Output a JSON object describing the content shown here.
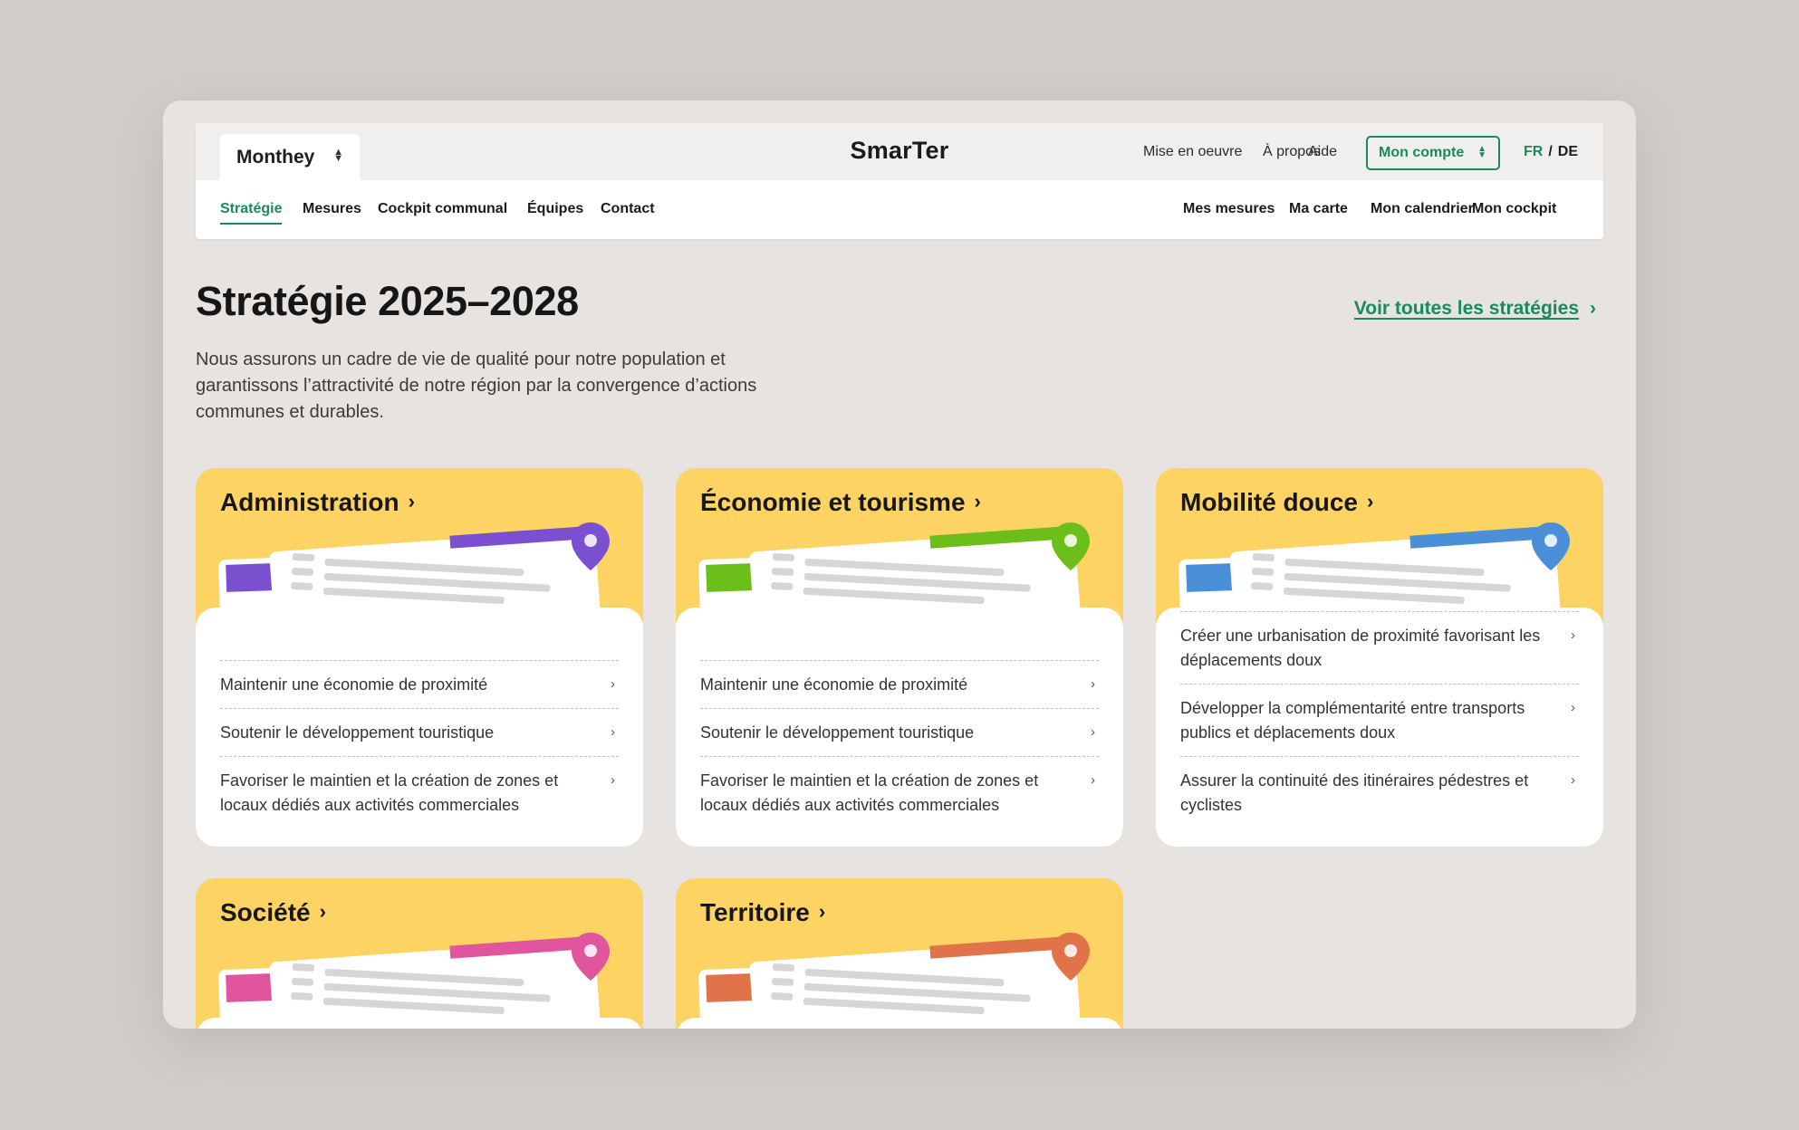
{
  "header": {
    "commune": "Monthey",
    "brand": "SmarTer",
    "utility": [
      "Mise en oeuvre",
      "À propos",
      "Aide"
    ],
    "account": "Mon compte",
    "lang_fr": "FR",
    "lang_sep": "/",
    "lang_de": "DE",
    "nav_left": [
      "Stratégie",
      "Mesures",
      "Cockpit communal",
      "Équipes",
      "Contact"
    ],
    "nav_right": [
      "Mes mesures",
      "Ma carte",
      "Mon calendrier",
      "Mon cockpit"
    ]
  },
  "page": {
    "title": "Stratégie 2025–2028",
    "all_link": "Voir toutes les stratégies",
    "lede": "Nous assurons un cadre de vie de qualité pour notre population et garantissons l’attractivité de notre région par la convergence d’actions communes et durables."
  },
  "cards": [
    {
      "title": "Administration",
      "accent": "#7a4fd0",
      "items": [
        "Maintenir une économie de proximité",
        "Soutenir le développement touristique",
        "Favoriser le maintien et la création de zones et locaux dédiés aux activités commerciales"
      ]
    },
    {
      "title": "Économie et tourisme",
      "accent": "#6cbf1a",
      "items": [
        "Maintenir une économie de proximité",
        "Soutenir le développement touristique",
        "Favoriser le maintien et la création de zones et locaux dédiés aux activités commerciales"
      ]
    },
    {
      "title": "Mobilité douce",
      "accent": "#4a8fd8",
      "items": [
        "Créer une urbanisation de proximité favorisant les déplacements doux",
        "Développer la complémentarité entre transports publics et déplacements doux",
        "Assurer la continuité des itinéraires pédestres et cyclistes"
      ]
    },
    {
      "title": "Société",
      "accent": "#e0559e",
      "items": []
    },
    {
      "title": "Territoire",
      "accent": "#e0734a",
      "items": []
    }
  ],
  "colors": {
    "brand_green": "#1a8a5e",
    "card_yellow": "#fdd363",
    "page_bg": "#e6e3e1"
  },
  "icons": {
    "chevron": "chevron-right-icon",
    "updown": "up-down-arrows-icon",
    "pin": "map-pin-icon"
  }
}
